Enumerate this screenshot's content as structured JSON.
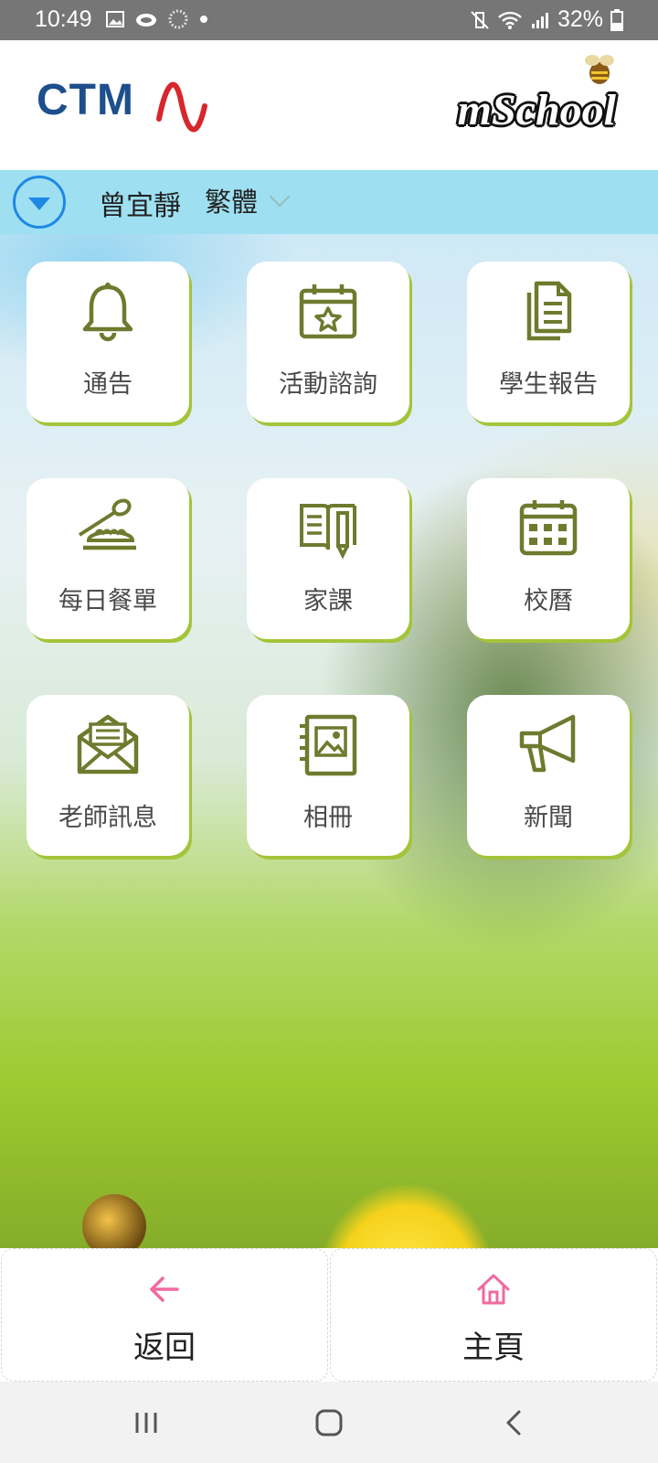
{
  "status_bar": {
    "time": "10:49",
    "battery": "32%",
    "icons_left": [
      "image-icon",
      "cloud-icon",
      "spinner-icon",
      "dot-icon"
    ],
    "icons_right": [
      "mute-vibrate-icon",
      "wifi-icon",
      "signal-icon",
      "battery-icon"
    ]
  },
  "header": {
    "left_logo": "CTM",
    "right_logo": "mSchool"
  },
  "user_bar": {
    "user_name": "曾宜靜",
    "language": "繁體"
  },
  "grid": {
    "items": [
      {
        "label": "通告",
        "icon": "bell-icon"
      },
      {
        "label": "活動諮詢",
        "icon": "calendar-star-icon"
      },
      {
        "label": "學生報告",
        "icon": "documents-icon"
      },
      {
        "label": "每日餐單",
        "icon": "meal-icon"
      },
      {
        "label": "家課",
        "icon": "book-pencil-icon"
      },
      {
        "label": "校曆",
        "icon": "calendar-grid-icon"
      },
      {
        "label": "老師訊息",
        "icon": "envelope-icon"
      },
      {
        "label": "相冊",
        "icon": "photo-album-icon"
      },
      {
        "label": "新聞",
        "icon": "megaphone-icon"
      }
    ]
  },
  "bottom_nav": {
    "back_label": "返回",
    "home_label": "主頁"
  },
  "colors": {
    "accent_blue": "#1e88e5",
    "user_bar_bg": "#9ee0f1",
    "icon_olive": "#6f7a2e",
    "tile_shadow": "#a4c43a",
    "nav_pink": "#f06aa0"
  }
}
